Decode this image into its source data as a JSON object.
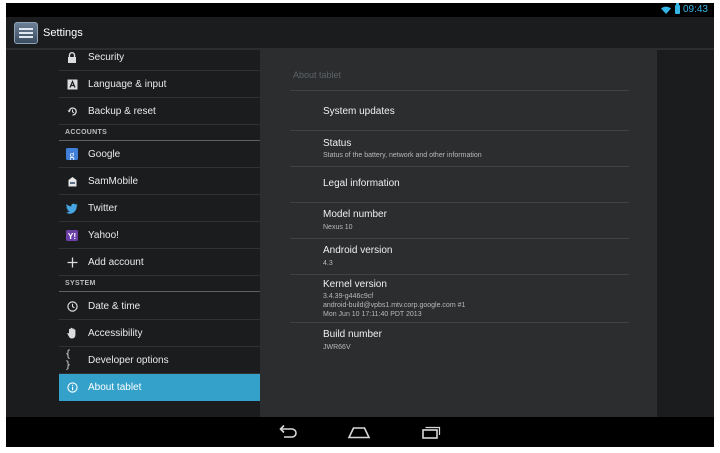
{
  "status_bar": {
    "time": "09:43",
    "wifi_icon": "wifi-icon",
    "battery_icon": "battery-icon",
    "accent": "#33b5e5"
  },
  "action_bar": {
    "title": "Settings",
    "app_icon": "settings-app-icon"
  },
  "sidebar": {
    "items": [
      {
        "label": "Security",
        "icon": "lock-icon"
      },
      {
        "label": "Language & input",
        "icon": "language-icon"
      },
      {
        "label": "Backup & reset",
        "icon": "backup-reset-icon"
      },
      {
        "header": "ACCOUNTS"
      },
      {
        "label": "Google",
        "icon": "google-icon"
      },
      {
        "label": "SamMobile",
        "icon": "sammobile-icon"
      },
      {
        "label": "Twitter",
        "icon": "twitter-icon"
      },
      {
        "label": "Yahoo!",
        "icon": "yahoo-icon"
      },
      {
        "label": "Add account",
        "icon": "plus-icon"
      },
      {
        "header": "SYSTEM"
      },
      {
        "label": "Date & time",
        "icon": "clock-icon"
      },
      {
        "label": "Accessibility",
        "icon": "hand-icon"
      },
      {
        "label": "Developer options",
        "icon": "braces-icon"
      },
      {
        "label": "About tablet",
        "icon": "info-icon",
        "selected": true
      }
    ],
    "selected_color": "#33a1c9"
  },
  "about": {
    "title": "About tablet",
    "items": [
      {
        "title": "System updates"
      },
      {
        "title": "Status",
        "summary": "Status of the battery, network and other information"
      },
      {
        "title": "Legal information"
      },
      {
        "title": "Model number",
        "summary": "Nexus 10"
      },
      {
        "title": "Android version",
        "summary": "4.3"
      },
      {
        "title": "Kernel version",
        "summary": "3.4.39-g446c9cf\nandroid-build@vpbs1.mtv.corp.google.com #1\nMon Jun 10 17:11:40 PDT 2013"
      },
      {
        "title": "Build number",
        "summary": "JWR66V"
      }
    ]
  },
  "nav_bar": {
    "back_icon": "back-icon",
    "home_icon": "home-icon",
    "recents_icon": "recent-apps-icon"
  }
}
